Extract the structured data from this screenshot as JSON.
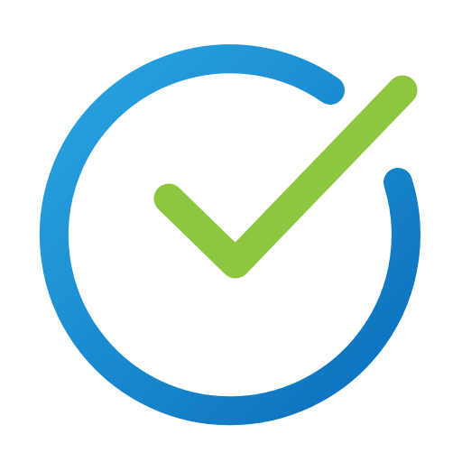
{
  "icon": {
    "name": "check-circle-icon",
    "background": "#ffffff",
    "ring_gradient": [
      "#2aa4e0",
      "#0a6fbd"
    ],
    "check_color": "#8dc63f"
  }
}
